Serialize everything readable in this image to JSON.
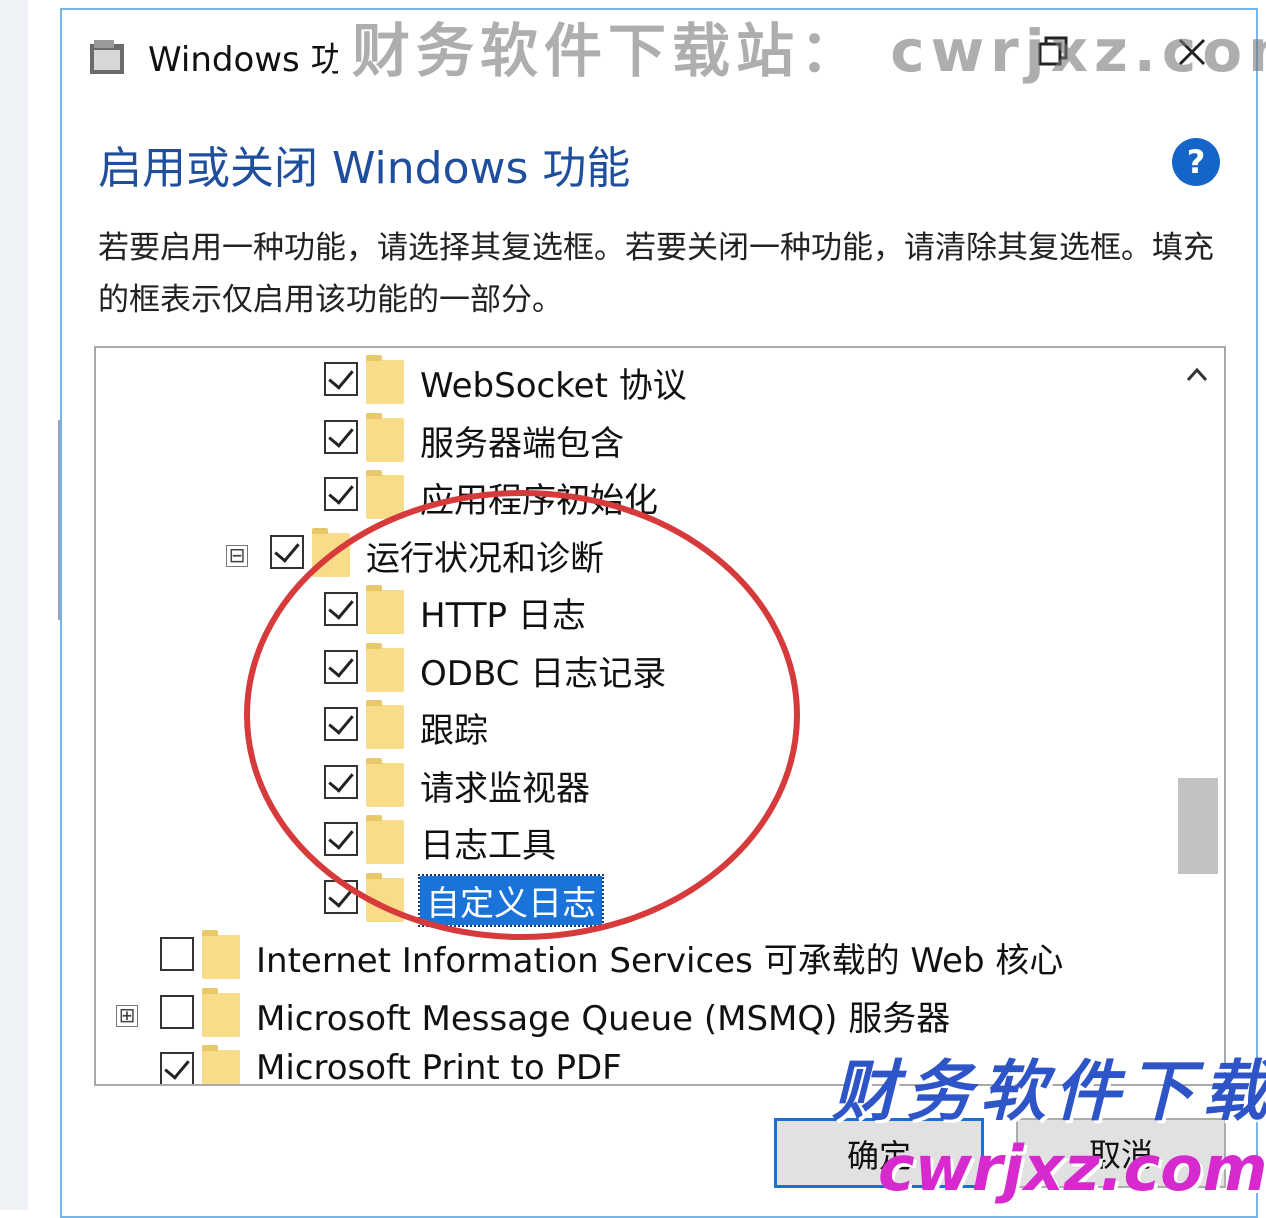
{
  "window": {
    "title": "Windows 功能"
  },
  "watermark": {
    "top": "财务软件下载站： cwrjxz.com",
    "bottom_text": "财务软件下载",
    "bottom_url": "cwrjxz.com"
  },
  "header": {
    "heading": "启用或关闭 Windows 功能",
    "help_glyph": "?",
    "description": "若要启用一种功能，请选择其复选框。若要关闭一种功能，请清除其复选框。填充的框表示仅启用该功能的一部分。"
  },
  "features": [
    {
      "label": "WebSocket 协议",
      "checked": true,
      "level": 3
    },
    {
      "label": "服务器端包含",
      "checked": true,
      "level": 3
    },
    {
      "label": "应用程序初始化",
      "checked": true,
      "level": 3
    },
    {
      "label": "运行状况和诊断",
      "checked": true,
      "level": 2,
      "expander": "⊟"
    },
    {
      "label": "HTTP 日志",
      "checked": true,
      "level": 3
    },
    {
      "label": "ODBC 日志记录",
      "checked": true,
      "level": 3
    },
    {
      "label": "跟踪",
      "checked": true,
      "level": 3
    },
    {
      "label": "请求监视器",
      "checked": true,
      "level": 3
    },
    {
      "label": "日志工具",
      "checked": true,
      "level": 3
    },
    {
      "label": "自定义日志",
      "checked": true,
      "level": 3,
      "selected": true
    },
    {
      "label": "Internet Information Services 可承载的 Web 核心",
      "checked": false,
      "level": 1
    },
    {
      "label": "Microsoft Message Queue (MSMQ) 服务器",
      "checked": false,
      "level": 1,
      "expander": "⊞"
    },
    {
      "label": "Microsoft Print to PDF",
      "checked": true,
      "level": 1
    }
  ],
  "buttons": {
    "ok": "确定",
    "cancel": "取消"
  },
  "colors": {
    "heading": "#1e4e9c",
    "selection": "#1a73d9",
    "annotation_circle": "#d63a3a",
    "folder": "#f8dc8a"
  }
}
